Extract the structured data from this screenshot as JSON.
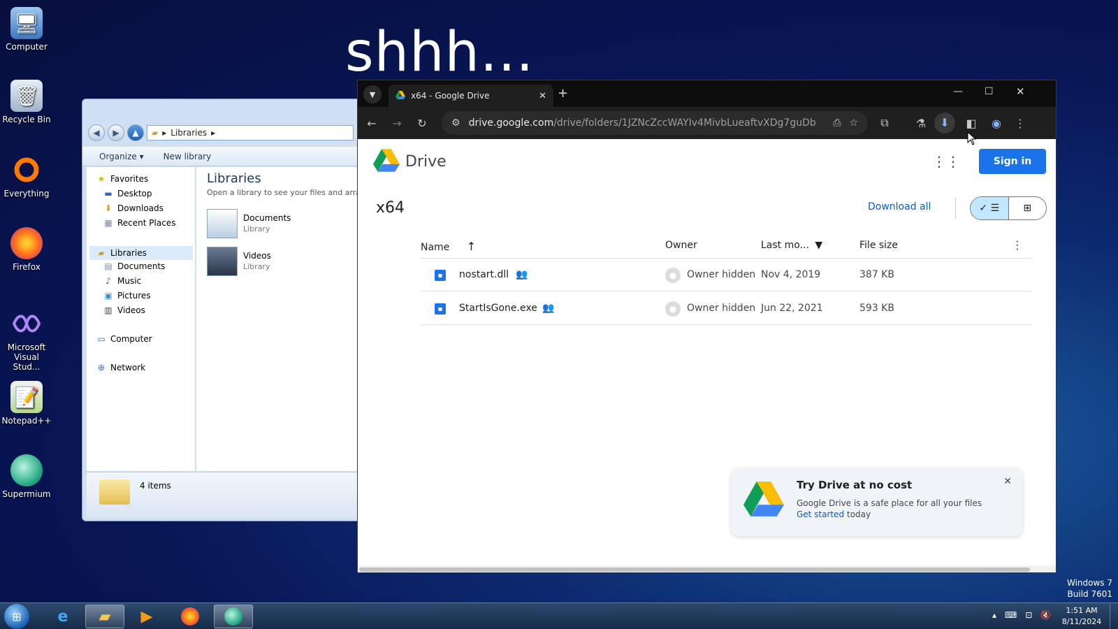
{
  "desktop": {
    "overlay_text": "shhh...",
    "icons": [
      {
        "label": "Computer",
        "icon": "computer-icon"
      },
      {
        "label": "Recycle Bin",
        "icon": "recycle-bin-icon"
      },
      {
        "label": "Everything",
        "icon": "everything-icon"
      },
      {
        "label": "Firefox",
        "icon": "firefox-icon"
      },
      {
        "label": "Microsoft Visual Stud...",
        "icon": "visual-studio-icon"
      },
      {
        "label": "Notepad++",
        "icon": "notepadpp-icon"
      },
      {
        "label": "Supermium",
        "icon": "supermium-icon"
      }
    ],
    "watermark": {
      "line1": "Windows 7",
      "line2": "Build 7601"
    }
  },
  "explorer": {
    "breadcrumb": "Libraries",
    "toolbar": {
      "organize": "Organize",
      "new_library": "New library"
    },
    "tree": {
      "favorites": "Favorites",
      "desktop": "Desktop",
      "downloads": "Downloads",
      "recent": "Recent Places",
      "libraries": "Libraries",
      "documents": "Documents",
      "music": "Music",
      "pictures": "Pictures",
      "videos": "Videos",
      "computer": "Computer",
      "network": "Network"
    },
    "main": {
      "title": "Libraries",
      "subtitle": "Open a library to see your files and arra",
      "items": [
        {
          "name": "Documents",
          "type": "Library"
        },
        {
          "name": "Videos",
          "type": "Library"
        }
      ]
    },
    "status": "4 items"
  },
  "browser": {
    "tab_title": "x64 - Google Drive",
    "url_host": "drive.google.com",
    "url_path": "/drive/folders/1JZNcZccWAYIv4MivbLueaftvXDg7guDb"
  },
  "drive": {
    "brand": "Drive",
    "sign_in": "Sign in",
    "folder_title": "x64",
    "download_all": "Download all",
    "columns": {
      "name": "Name",
      "owner": "Owner",
      "modified": "Last mo...",
      "size": "File size"
    },
    "files": [
      {
        "name": "nostart.dll",
        "owner": "Owner hidden",
        "modified": "Nov 4, 2019",
        "size": "387 KB"
      },
      {
        "name": "StartIsGone.exe",
        "owner": "Owner hidden",
        "modified": "Jun 22, 2021",
        "size": "593 KB"
      }
    ],
    "promo": {
      "title": "Try Drive at no cost",
      "body": "Google Drive is a safe place for all your files",
      "link": "Get started",
      "suffix": "today"
    }
  },
  "taskbar": {
    "time": "1:51 AM",
    "date": "8/11/2024"
  },
  "colors": {
    "accent": "#1a73e8",
    "toggle_on": "#c2e7ff"
  }
}
